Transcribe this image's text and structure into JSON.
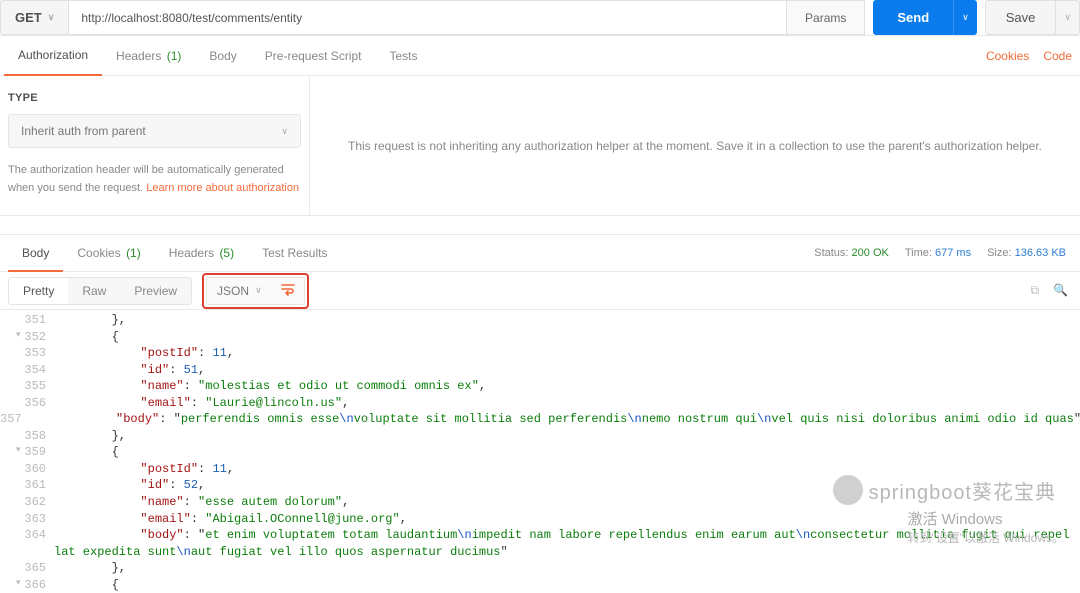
{
  "request": {
    "method": "GET",
    "url": "http://localhost:8080/test/comments/entity",
    "params_label": "Params",
    "send_label": "Send",
    "save_label": "Save"
  },
  "req_tabs": {
    "authorization": "Authorization",
    "headers": "Headers",
    "headers_count": "(1)",
    "body": "Body",
    "prerequest": "Pre-request Script",
    "tests": "Tests",
    "cookies_link": "Cookies",
    "code_link": "Code"
  },
  "auth": {
    "type_label": "TYPE",
    "type_value": "Inherit auth from parent",
    "note_prefix": "The authorization header will be automatically generated when you send the request. ",
    "note_link": "Learn more about authorization",
    "right_msg": "This request is not inheriting any authorization helper at the moment. Save it in a collection to use the parent's authorization helper."
  },
  "resp_tabs": {
    "body": "Body",
    "cookies": "Cookies",
    "cookies_count": "(1)",
    "headers": "Headers",
    "headers_count": "(5)",
    "test_results": "Test Results"
  },
  "status": {
    "status_label": "Status:",
    "status_value": "200 OK",
    "time_label": "Time:",
    "time_value": "677 ms",
    "size_label": "Size:",
    "size_value": "136.63 KB"
  },
  "view": {
    "pretty": "Pretty",
    "raw": "Raw",
    "preview": "Preview",
    "format": "JSON"
  },
  "code": {
    "lines": [
      {
        "n": "351",
        "ind": 2,
        "txt": "},"
      },
      {
        "n": "352",
        "ind": 2,
        "txt": "{",
        "tw": "open"
      },
      {
        "n": "353",
        "ind": 3,
        "kv": {
          "k": "postId",
          "type": "num",
          "v": "11",
          "comma": true
        }
      },
      {
        "n": "354",
        "ind": 3,
        "kv": {
          "k": "id",
          "type": "num",
          "v": "51",
          "comma": true
        }
      },
      {
        "n": "355",
        "ind": 3,
        "kv": {
          "k": "name",
          "type": "str",
          "v": "molestias et odio ut commodi omnis ex",
          "comma": true
        }
      },
      {
        "n": "356",
        "ind": 3,
        "kv": {
          "k": "email",
          "type": "email",
          "v": "Laurie@lincoln.us",
          "comma": true
        }
      },
      {
        "n": "357",
        "ind": 3,
        "kv": {
          "k": "body",
          "type": "body",
          "segs": [
            "perferendis omnis esse",
            "voluptate sit mollitia sed perferendis",
            "nemo nostrum qui",
            "vel quis nisi doloribus animi odio id quas"
          ],
          "comma": false
        }
      },
      {
        "n": "358",
        "ind": 2,
        "txt": "},"
      },
      {
        "n": "359",
        "ind": 2,
        "txt": "{",
        "tw": "open"
      },
      {
        "n": "360",
        "ind": 3,
        "kv": {
          "k": "postId",
          "type": "num",
          "v": "11",
          "comma": true
        }
      },
      {
        "n": "361",
        "ind": 3,
        "kv": {
          "k": "id",
          "type": "num",
          "v": "52",
          "comma": true
        }
      },
      {
        "n": "362",
        "ind": 3,
        "kv": {
          "k": "name",
          "type": "str",
          "v": "esse autem dolorum",
          "comma": true
        }
      },
      {
        "n": "363",
        "ind": 3,
        "kv": {
          "k": "email",
          "type": "email",
          "v": "Abigail.OConnell@june.org",
          "comma": true
        }
      },
      {
        "n": "364",
        "ind": 3,
        "wrap": true,
        "kv": {
          "k": "body",
          "type": "body",
          "segs": [
            "et enim voluptatem totam laudantium",
            "impedit nam labore repellendus enim earum aut",
            "consectetur mollitia fugit qui repellat expedita sunt",
            "aut fugiat vel illo quos aspernatur ducimus"
          ],
          "comma": false
        }
      },
      {
        "n": "365",
        "ind": 2,
        "txt": "},"
      },
      {
        "n": "366",
        "ind": 2,
        "txt": "{",
        "tw": "open"
      }
    ]
  },
  "watermark": {
    "text": "springboot葵花宝典",
    "activate_title": "激活 Windows",
    "activate_sub": "转到\"设置\"以激活 Windows。"
  }
}
